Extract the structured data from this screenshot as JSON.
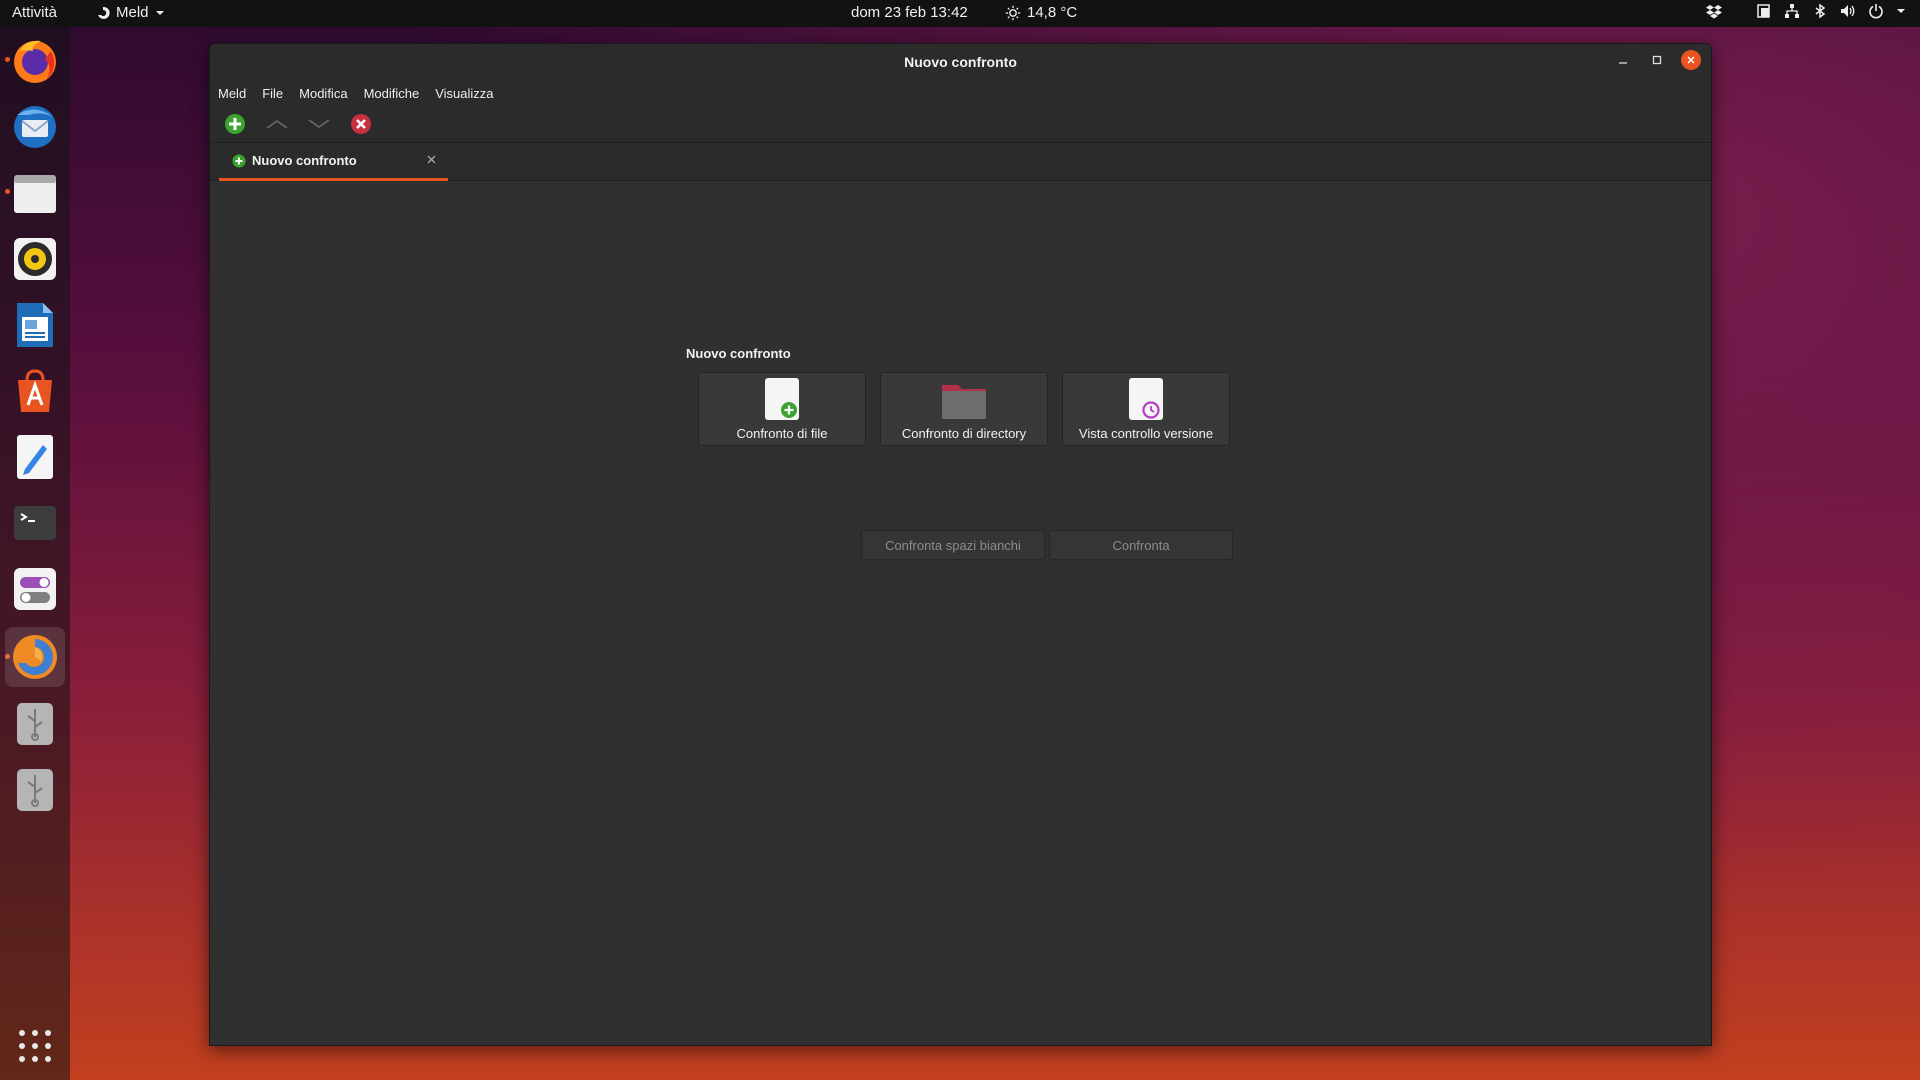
{
  "topbar": {
    "activities": "Attività",
    "app_name": "Meld",
    "clock": "dom 23 feb  13:42",
    "weather": "14,8 °C"
  },
  "dock": {
    "items": [
      "firefox",
      "thunderbird",
      "files",
      "rhythmbox",
      "libreoffice-writer",
      "app-center",
      "text-editor",
      "terminal",
      "settings",
      "meld",
      "usb-drive-1",
      "usb-drive-2"
    ]
  },
  "window": {
    "title": "Nuovo confronto",
    "menu": [
      "Meld",
      "File",
      "Modifica",
      "Modifiche",
      "Visualizza"
    ],
    "tab": {
      "label": "Nuovo confronto"
    },
    "section_title": "Nuovo confronto",
    "choices": [
      {
        "label": "Confronto di file"
      },
      {
        "label": "Confronto di directory"
      },
      {
        "label": "Vista controllo versione"
      }
    ],
    "buttons": {
      "blank": "Confronta spazi bianchi",
      "compare": "Confronta"
    }
  },
  "colors": {
    "accent": "#e95420",
    "window_bg": "#303030",
    "topbar_bg": "#121212"
  }
}
